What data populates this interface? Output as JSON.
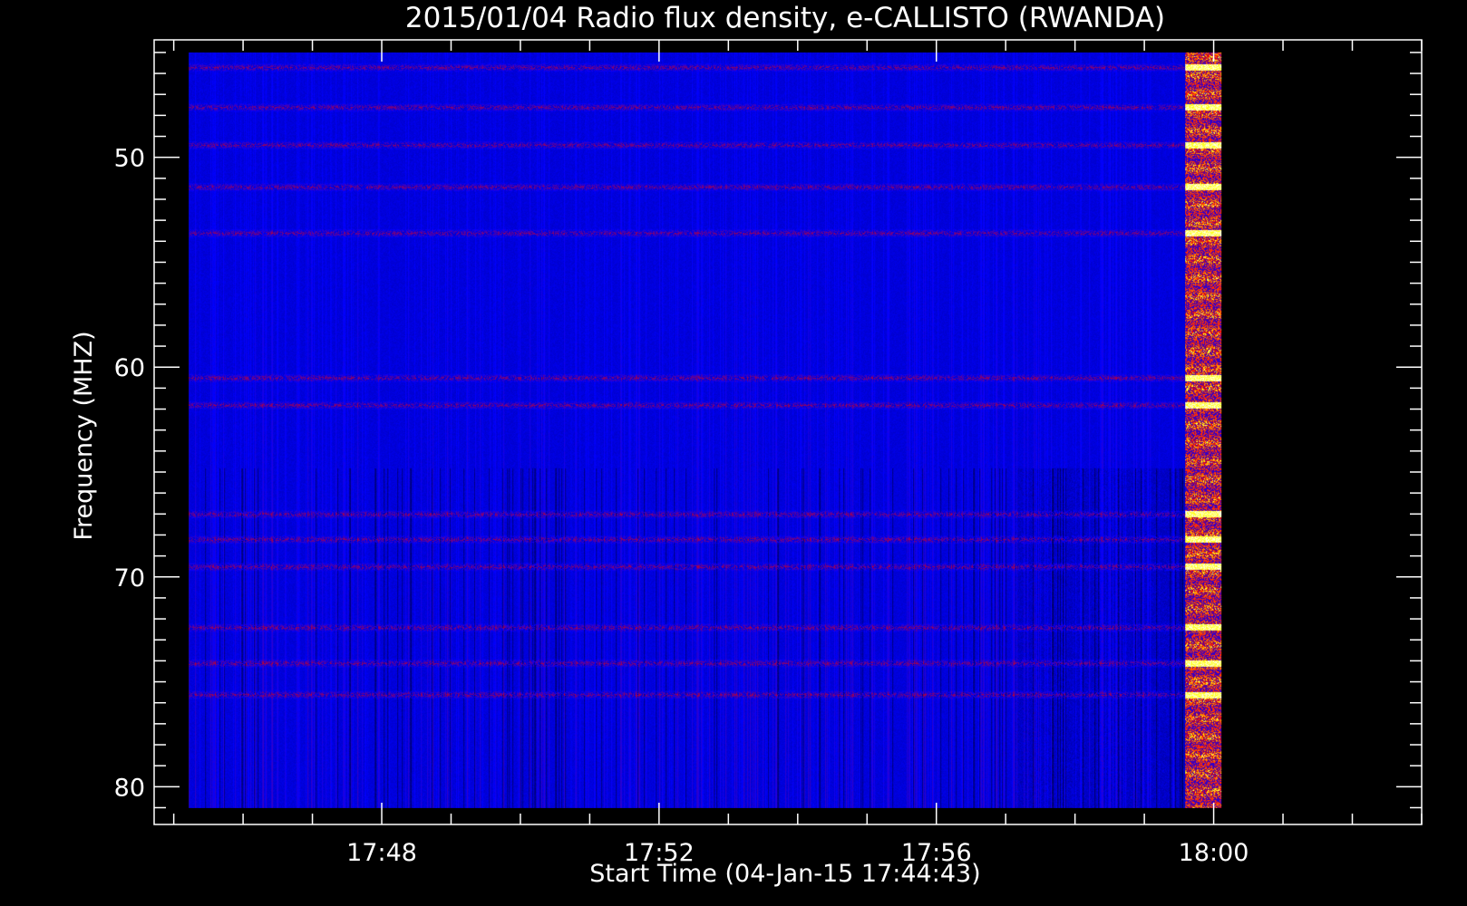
{
  "chart_data": {
    "type": "heatmap",
    "title": "2015/01/04  Radio flux density, e-CALLISTO (RWANDA)",
    "xlabel": "Start Time (04-Jan-15 17:44:43)",
    "ylabel": "Frequency (MHZ)",
    "x_range": [
      "17:45:13",
      "18:00:07"
    ],
    "y_range": [
      45,
      81
    ],
    "axis_range_x": [
      "17:44:43",
      "18:03:00"
    ],
    "axis_range_y": [
      44.4,
      81.8
    ],
    "y_inverted": true,
    "x_major_ticks": [
      {
        "label": "17:48",
        "minutes": 3.283
      },
      {
        "label": "17:52",
        "minutes": 7.283
      },
      {
        "label": "17:56",
        "minutes": 11.283
      },
      {
        "label": "18:00",
        "minutes": 15.283
      }
    ],
    "y_major_ticks": [
      50,
      60,
      70,
      80
    ],
    "colormap": [
      "#000000",
      "#0000ff",
      "#ff0000",
      "#ffff00",
      "#ffffff"
    ],
    "background_color": "#0a0af0",
    "features": [
      {
        "type": "bright_burst",
        "time_start": "17:59:35",
        "time_end": "18:00:07",
        "freq_range": [
          45,
          81
        ]
      }
    ],
    "bright_frequency_bands_mhz": [
      45.7,
      47.6,
      49.4,
      51.4,
      53.6,
      60.5,
      61.8,
      67.0,
      68.2,
      69.5,
      72.4,
      74.1,
      75.6
    ]
  }
}
